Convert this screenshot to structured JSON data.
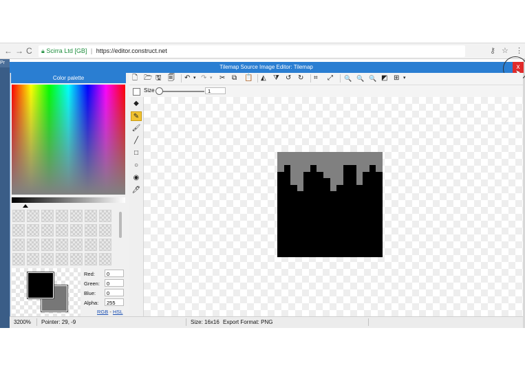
{
  "browser": {
    "nav_back": "←",
    "nav_forward": "→",
    "nav_reload": "C",
    "secure_label": "Scirra Ltd [GB]",
    "url": "https://editor.construct.net",
    "key_icon": "⚷",
    "star_icon": "☆",
    "menu_icon": "⋮"
  },
  "background_page": {
    "tab_text": "Pr"
  },
  "dialog": {
    "title": "Tilemap Source Image Editor: Tilemap",
    "close_label": "x"
  },
  "palette": {
    "header": "Color palette",
    "channels": [
      {
        "label": "Red:",
        "value": "0"
      },
      {
        "label": "Green:",
        "value": "0"
      },
      {
        "label": "Blue:",
        "value": "0"
      },
      {
        "label": "Alpha:",
        "value": "255"
      }
    ],
    "mode_rgb": "RGB",
    "mode_sep": "-",
    "mode_hsl": "HSL",
    "primary_color": "#000000",
    "secondary_color": "#777777"
  },
  "toolbar": {
    "new": "🗋",
    "open": "🗁",
    "save": "🖫",
    "export": "🗐",
    "undo": "↶",
    "redo": "↷",
    "dropdown": "▾",
    "cut": "✂",
    "copy": "⧉",
    "paste": "📋",
    "mirror": "◭",
    "flip": "⧩",
    "rotate_ccw": "↺",
    "rotate_cw": "↻",
    "crop": "⌗",
    "resize": "⤢",
    "zoom_in": "🔍",
    "zoom_out": "🔍",
    "zoom_fit": "🔍",
    "toggle_bg": "◩",
    "grid": "⊞",
    "size_label": "Size",
    "size_value": "1"
  },
  "tools": {
    "eraser": "◆",
    "pencil": "✎",
    "brush": "🖌",
    "line": "╱",
    "rectangle": "□",
    "ellipse": "○",
    "fill": "◉",
    "picker": "🖊"
  },
  "status": {
    "zoom": "3200%",
    "pointer": "Pointer: 29, -9",
    "size": "Size: 16x16",
    "export_format": "Export Format: PNG"
  }
}
